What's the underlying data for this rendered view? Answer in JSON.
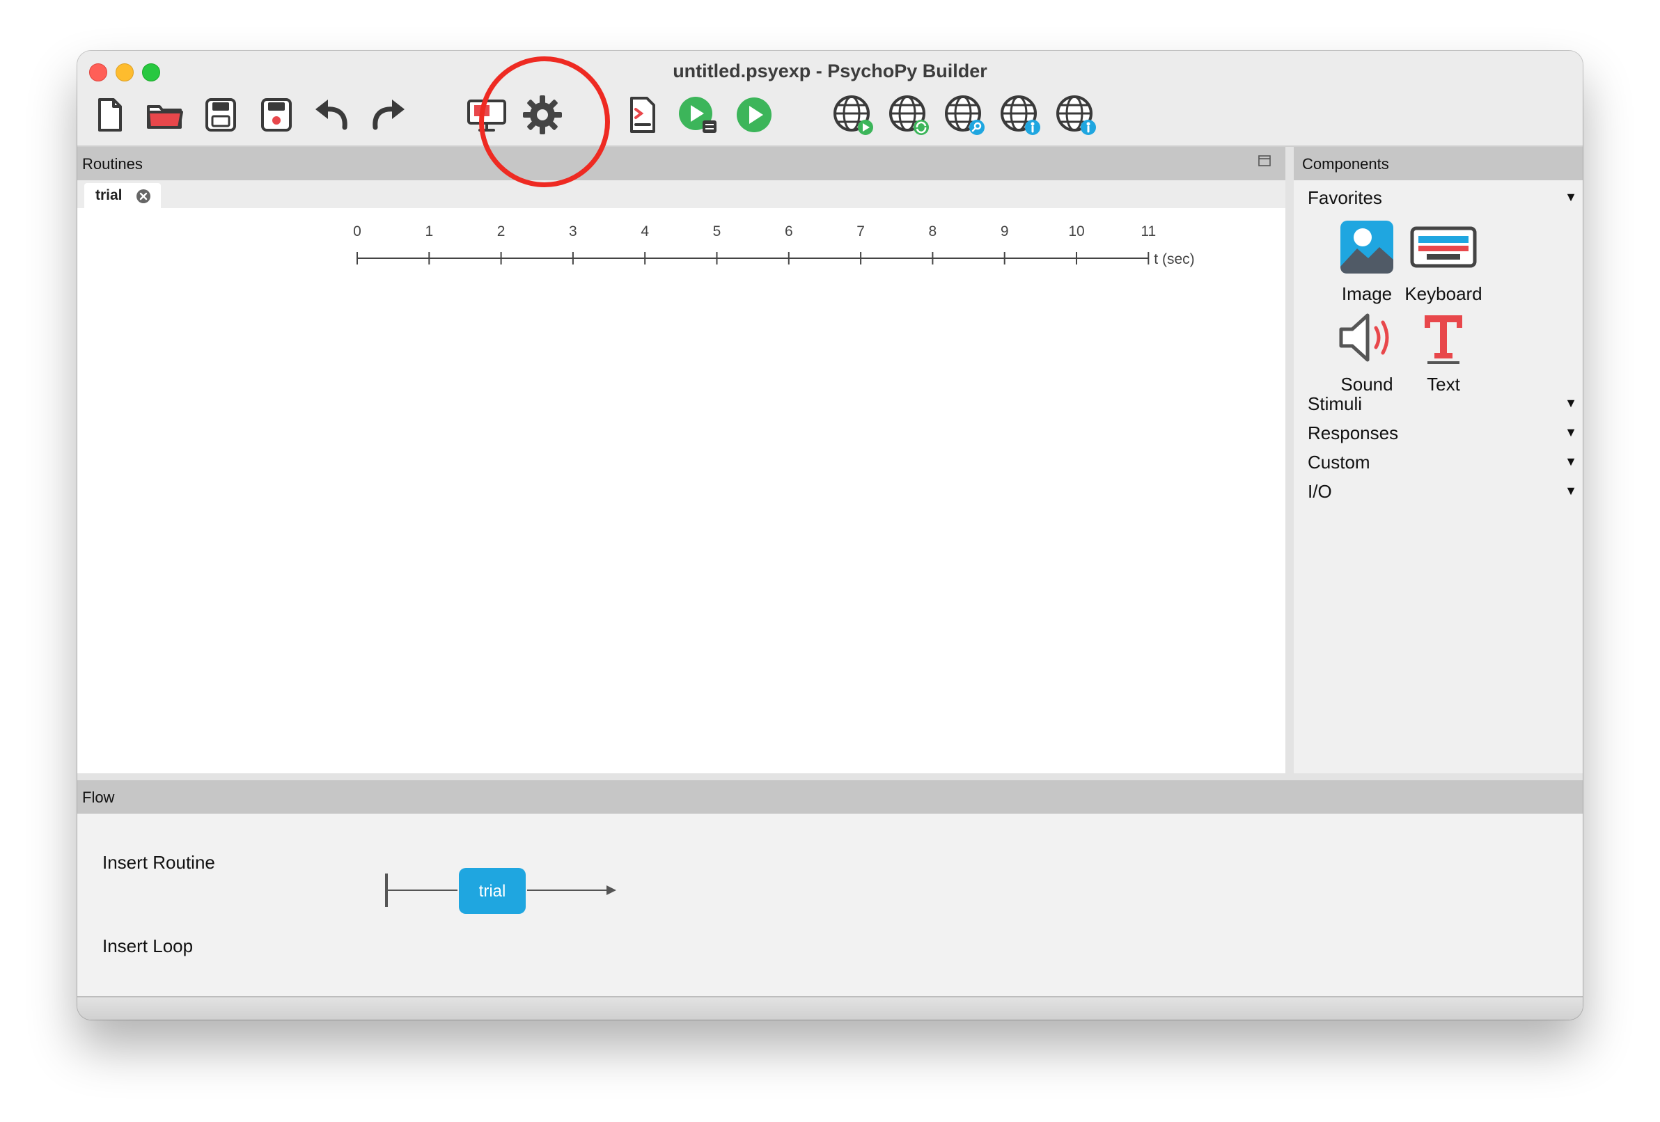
{
  "window": {
    "title": "untitled.psyexp - PsychoPy Builder"
  },
  "toolbar": {
    "buttons": [
      {
        "name": "new-file",
        "icon": "new-file-icon"
      },
      {
        "name": "open",
        "icon": "folder-icon"
      },
      {
        "name": "save",
        "icon": "save-icon"
      },
      {
        "name": "save-as",
        "icon": "save-as-icon"
      },
      {
        "name": "undo",
        "icon": "undo-icon"
      },
      {
        "name": "redo",
        "icon": "redo-icon"
      },
      {
        "name": "monitor-center",
        "icon": "monitor-icon"
      },
      {
        "name": "experiment-settings",
        "icon": "gear-icon"
      },
      {
        "name": "compile-script",
        "icon": "script-icon"
      },
      {
        "name": "run-pilot",
        "icon": "pilot-icon"
      },
      {
        "name": "run",
        "icon": "play-icon"
      },
      {
        "name": "pavlovia-run",
        "icon": "globe-play-icon"
      },
      {
        "name": "pavlovia-sync",
        "icon": "globe-sync-icon"
      },
      {
        "name": "pavlovia-search",
        "icon": "globe-search-icon"
      },
      {
        "name": "pavlovia-user",
        "icon": "globe-user-icon"
      },
      {
        "name": "pavlovia-info",
        "icon": "globe-info-icon"
      }
    ]
  },
  "routines": {
    "header": "Routines",
    "tabs": [
      {
        "label": "trial"
      }
    ],
    "timeline": {
      "ticks": [
        "0",
        "1",
        "2",
        "3",
        "4",
        "5",
        "6",
        "7",
        "8",
        "9",
        "10",
        "11"
      ],
      "unit": "t (sec)"
    }
  },
  "components": {
    "header": "Components",
    "favorites": {
      "label": "Favorites",
      "items": [
        {
          "label": "Image",
          "icon": "image-icon"
        },
        {
          "label": "Keyboard",
          "icon": "keyboard-icon"
        },
        {
          "label": "Sound",
          "icon": "speaker-icon"
        },
        {
          "label": "Text",
          "icon": "text-icon"
        }
      ]
    },
    "categories": [
      "Stimuli",
      "Responses",
      "Custom",
      "I/O"
    ]
  },
  "flow": {
    "header": "Flow",
    "insert_routine": "Insert Routine",
    "insert_loop": "Insert Loop",
    "routines": [
      "trial"
    ]
  },
  "colors": {
    "accent": "#1fa6e0",
    "highlight": "#ee2a22",
    "panel_header": "#c6c6c6",
    "run_green": "#3cb55a",
    "text_red": "#e8474b"
  }
}
